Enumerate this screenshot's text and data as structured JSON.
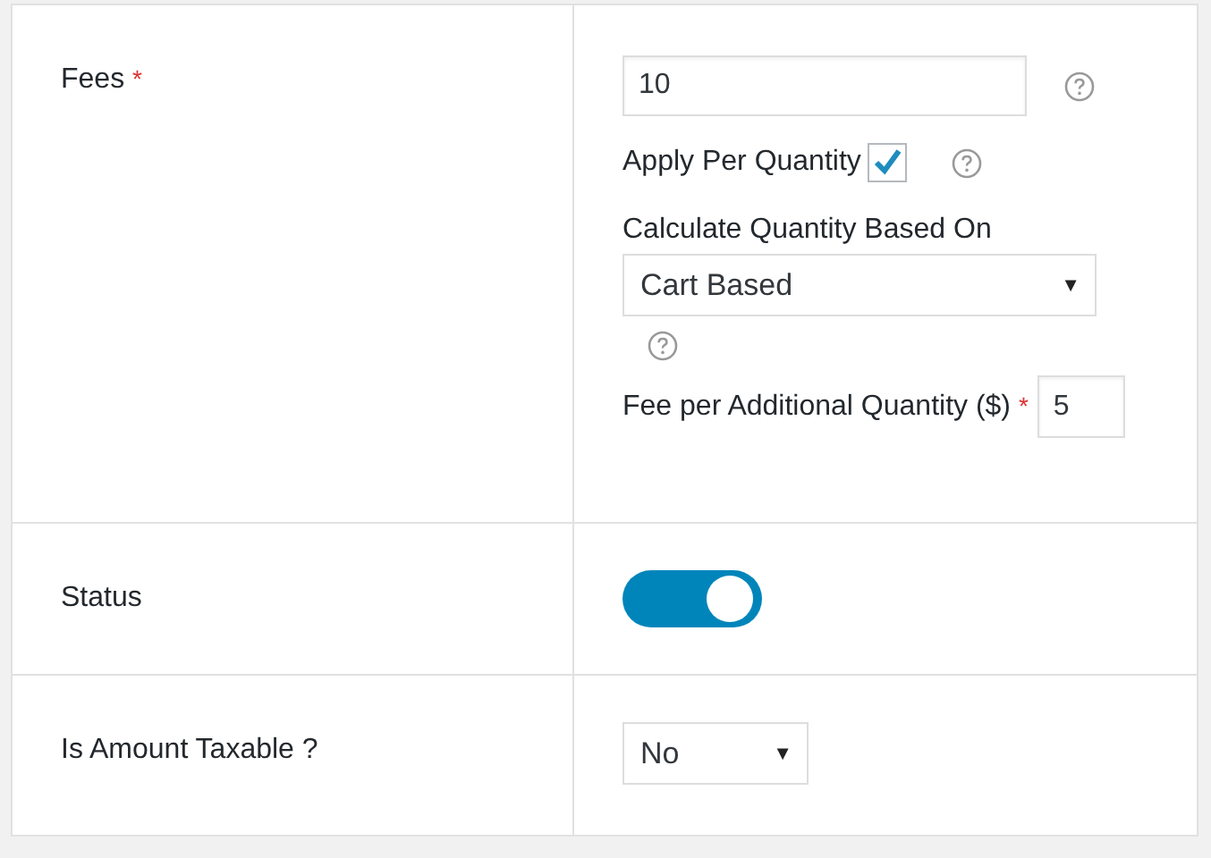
{
  "rows": [
    {
      "kind": "fees",
      "label": "Fees",
      "required_mark": "*",
      "value": "10",
      "apply_per_quantity": {
        "label": "Apply Per Quantity",
        "checked": true
      },
      "quantity_basis": {
        "label": "Calculate Quantity Based On",
        "value": "Cart Based",
        "caret": "▼"
      },
      "additional_fee": {
        "label": "Fee per Additional Quantity ($)",
        "required_mark": "*",
        "value": "5"
      }
    },
    {
      "kind": "toggle",
      "label": "Status",
      "on": true
    },
    {
      "kind": "select",
      "label": "Is Amount Taxable ?",
      "value": "No",
      "caret": "▼"
    }
  ]
}
